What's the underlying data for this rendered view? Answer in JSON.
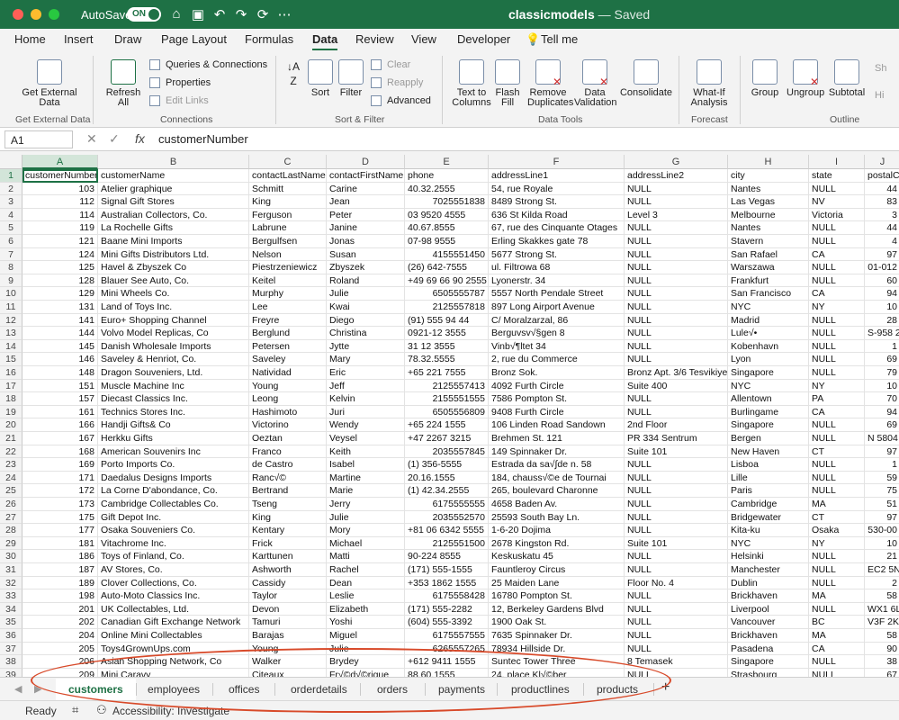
{
  "titlebar": {
    "autosave_label": "AutoSave",
    "autosave_state": "ON",
    "doc_name": "classicmodels",
    "doc_status": "— Saved"
  },
  "ribbon_tabs": [
    "Home",
    "Insert",
    "Draw",
    "Page Layout",
    "Formulas",
    "Data",
    "Review",
    "View",
    "Developer",
    "Tell me"
  ],
  "ribbon": {
    "get_external_data": "Get External Data",
    "refresh_all": "Refresh All",
    "queries_connections": "Queries & Connections",
    "properties": "Properties",
    "edit_links": "Edit Links",
    "sort": "Sort",
    "filter": "Filter",
    "clear": "Clear",
    "reapply": "Reapply",
    "advanced": "Advanced",
    "text_to_columns": "Text to Columns",
    "flash_fill": "Flash Fill",
    "remove_duplicates": "Remove Duplicates",
    "data_validation": "Data Validation",
    "consolidate": "Consolidate",
    "what_if": "What-If Analysis",
    "group": "Group",
    "ungroup": "Ungroup",
    "subtotal": "Subtotal",
    "show_detail": "Sh",
    "hide_detail": "Hi",
    "groups": {
      "get_external_data": "Get External Data",
      "connections": "Connections",
      "sort_filter": "Sort & Filter",
      "data_tools": "Data Tools",
      "forecast": "Forecast",
      "outline": "Outline"
    }
  },
  "formula_bar": {
    "name_box": "A1",
    "formula": "customerNumber"
  },
  "columns": [
    "A",
    "B",
    "C",
    "D",
    "E",
    "F",
    "G",
    "H",
    "I",
    "J"
  ],
  "rows": [
    [
      "customerNumber",
      "customerName",
      "contactLastName",
      "contactFirstName",
      "phone",
      "addressLine1",
      "addressLine2",
      "city",
      "state",
      "postalC"
    ],
    [
      "103",
      "Atelier graphique",
      "Schmitt",
      "Carine",
      "40.32.2555",
      "54, rue Royale",
      "NULL",
      "Nantes",
      "NULL",
      "44"
    ],
    [
      "112",
      "Signal Gift Stores",
      "King",
      "Jean",
      "7025551838",
      "8489 Strong St.",
      "NULL",
      "Las Vegas",
      "NV",
      "83"
    ],
    [
      "114",
      "Australian Collectors, Co.",
      "Ferguson",
      "Peter",
      "03 9520 4555",
      "636 St Kilda Road",
      "Level 3",
      "Melbourne",
      "Victoria",
      "3"
    ],
    [
      "119",
      "La Rochelle Gifts",
      "Labrune",
      "Janine",
      "40.67.8555",
      "67, rue des Cinquante Otages",
      "NULL",
      "Nantes",
      "NULL",
      "44"
    ],
    [
      "121",
      "Baane Mini Imports",
      "Bergulfsen",
      "Jonas",
      "07-98 9555",
      "Erling Skakkes gate 78",
      "NULL",
      "Stavern",
      "NULL",
      "4"
    ],
    [
      "124",
      "Mini Gifts Distributors Ltd.",
      "Nelson",
      "Susan",
      "4155551450",
      "5677 Strong St.",
      "NULL",
      "San Rafael",
      "CA",
      "97"
    ],
    [
      "125",
      "Havel & Zbyszek Co",
      "Piestrzeniewicz",
      "Zbyszek",
      "(26) 642-7555",
      "ul. Filtrowa 68",
      "NULL",
      "Warszawa",
      "NULL",
      "01-012"
    ],
    [
      "128",
      "Blauer See Auto, Co.",
      "Keitel",
      "Roland",
      "+49 69 66 90 2555",
      "Lyonerstr. 34",
      "NULL",
      "Frankfurt",
      "NULL",
      "60"
    ],
    [
      "129",
      "Mini Wheels Co.",
      "Murphy",
      "Julie",
      "6505555787",
      "5557 North Pendale Street",
      "NULL",
      "San Francisco",
      "CA",
      "94"
    ],
    [
      "131",
      "Land of Toys Inc.",
      "Lee",
      "Kwai",
      "2125557818",
      "897 Long Airport Avenue",
      "NULL",
      "NYC",
      "NY",
      "10"
    ],
    [
      "141",
      "Euro+ Shopping Channel",
      "Freyre",
      "Diego",
      "(91) 555 94 44",
      "C/ Moralzarzal, 86",
      "NULL",
      "Madrid",
      "NULL",
      "28"
    ],
    [
      "144",
      "Volvo Model Replicas, Co",
      "Berglund",
      "Christina",
      "0921-12 3555",
      "Berguvsv√§gen  8",
      "NULL",
      "Lule√•",
      "NULL",
      "S-958 2"
    ],
    [
      "145",
      "Danish Wholesale Imports",
      "Petersen",
      "Jytte",
      "31 12 3555",
      "Vinb√¶ltet 34",
      "NULL",
      "Kobenhavn",
      "NULL",
      "1"
    ],
    [
      "146",
      "Saveley & Henriot, Co.",
      "Saveley",
      "Mary",
      "78.32.5555",
      "2, rue du Commerce",
      "NULL",
      "Lyon",
      "NULL",
      "69"
    ],
    [
      "148",
      "Dragon Souveniers, Ltd.",
      "Natividad",
      "Eric",
      "+65 221 7555",
      "Bronz Sok.",
      "Bronz Apt. 3/6 Tesvikiye",
      "Singapore",
      "NULL",
      "79"
    ],
    [
      "151",
      "Muscle Machine Inc",
      "Young",
      "Jeff",
      "2125557413",
      "4092 Furth Circle",
      "Suite 400",
      "NYC",
      "NY",
      "10"
    ],
    [
      "157",
      "Diecast Classics Inc.",
      "Leong",
      "Kelvin",
      "2155551555",
      "7586 Pompton St.",
      "NULL",
      "Allentown",
      "PA",
      "70"
    ],
    [
      "161",
      "Technics Stores Inc.",
      "Hashimoto",
      "Juri",
      "6505556809",
      "9408 Furth Circle",
      "NULL",
      "Burlingame",
      "CA",
      "94"
    ],
    [
      "166",
      "Handji Gifts& Co",
      "Victorino",
      "Wendy",
      "+65 224 1555",
      "106 Linden Road Sandown",
      "2nd Floor",
      "Singapore",
      "NULL",
      "69"
    ],
    [
      "167",
      "Herkku Gifts",
      "Oeztan",
      "Veysel",
      "+47 2267 3215",
      "Brehmen St. 121",
      "PR 334 Sentrum",
      "Bergen",
      "NULL",
      "N 5804"
    ],
    [
      "168",
      "American Souvenirs Inc",
      "Franco",
      "Keith",
      "2035557845",
      "149 Spinnaker Dr.",
      "Suite 101",
      "New Haven",
      "CT",
      "97"
    ],
    [
      "169",
      "Porto Imports Co.",
      "de Castro",
      "Isabel",
      "(1) 356-5555",
      "Estrada da sa√∫de n. 58",
      "NULL",
      "Lisboa",
      "NULL",
      "1"
    ],
    [
      "171",
      "Daedalus Designs Imports",
      "Ranc√©",
      "Martine",
      "20.16.1555",
      "184, chauss√©e de Tournai",
      "NULL",
      "Lille",
      "NULL",
      "59"
    ],
    [
      "172",
      "La Corne D'abondance, Co.",
      "Bertrand",
      "Marie",
      "(1) 42.34.2555",
      "265, boulevard Charonne",
      "NULL",
      "Paris",
      "NULL",
      "75"
    ],
    [
      "173",
      "Cambridge Collectables Co.",
      "Tseng",
      "Jerry",
      "6175555555",
      "4658 Baden Av.",
      "NULL",
      "Cambridge",
      "MA",
      "51"
    ],
    [
      "175",
      "Gift Depot Inc.",
      "King",
      "Julie",
      "2035552570",
      "25593 South Bay Ln.",
      "NULL",
      "Bridgewater",
      "CT",
      "97"
    ],
    [
      "177",
      "Osaka Souveniers Co.",
      "Kentary",
      "Mory",
      "+81 06 6342 5555",
      "1-6-20 Dojima",
      "NULL",
      "Kita-ku",
      "Osaka",
      "530-00"
    ],
    [
      "181",
      "Vitachrome Inc.",
      "Frick",
      "Michael",
      "2125551500",
      "2678 Kingston Rd.",
      "Suite 101",
      "NYC",
      "NY",
      "10"
    ],
    [
      "186",
      "Toys of Finland, Co.",
      "Karttunen",
      "Matti",
      "90-224 8555",
      "Keskuskatu 45",
      "NULL",
      "Helsinki",
      "NULL",
      "21"
    ],
    [
      "187",
      "AV Stores, Co.",
      "Ashworth",
      "Rachel",
      "(171) 555-1555",
      "Fauntleroy Circus",
      "NULL",
      "Manchester",
      "NULL",
      "EC2 5N"
    ],
    [
      "189",
      "Clover Collections, Co.",
      "Cassidy",
      "Dean",
      "+353 1862 1555",
      "25 Maiden Lane",
      "Floor No. 4",
      "Dublin",
      "NULL",
      "2"
    ],
    [
      "198",
      "Auto-Moto Classics Inc.",
      "Taylor",
      "Leslie",
      "6175558428",
      "16780 Pompton St.",
      "NULL",
      "Brickhaven",
      "MA",
      "58"
    ],
    [
      "201",
      "UK Collectables, Ltd.",
      "Devon",
      "Elizabeth",
      "(171) 555-2282",
      "12, Berkeley Gardens Blvd",
      "NULL",
      "Liverpool",
      "NULL",
      "WX1 6L"
    ],
    [
      "202",
      "Canadian Gift Exchange Network",
      "Tamuri",
      "Yoshi",
      "(604) 555-3392",
      "1900 Oak St.",
      "NULL",
      "Vancouver",
      "BC",
      "V3F 2K"
    ],
    [
      "204",
      "Online Mini Collectables",
      "Barajas",
      "Miguel",
      "6175557555",
      "7635 Spinnaker Dr.",
      "NULL",
      "Brickhaven",
      "MA",
      "58"
    ],
    [
      "205",
      "Toys4GrownUps.com",
      "Young",
      "Julie",
      "6265557265",
      "78934 Hillside Dr.",
      "NULL",
      "Pasadena",
      "CA",
      "90"
    ],
    [
      "206",
      "Asian Shopping Network, Co",
      "Walker",
      "Brydey",
      "+612 9411 1555",
      "Suntec Tower Three",
      "8 Temasek",
      "Singapore",
      "NULL",
      "38"
    ],
    [
      "209",
      "Mini Caravy",
      "Citeaux",
      "Fr√©d√©rique",
      "88.60.1555",
      "24, place Kl√©ber",
      "NULL",
      "Strasbourg",
      "NULL",
      "67"
    ]
  ],
  "sheet_tabs": [
    "customers",
    "employees",
    "offices",
    "orderdetails",
    "orders",
    "payments",
    "productlines",
    "products"
  ],
  "status": {
    "ready": "Ready",
    "accessibility": "Accessibility: Investigate"
  },
  "colors": {
    "accent": "#1e7145",
    "annotation": "#d84a2a"
  }
}
